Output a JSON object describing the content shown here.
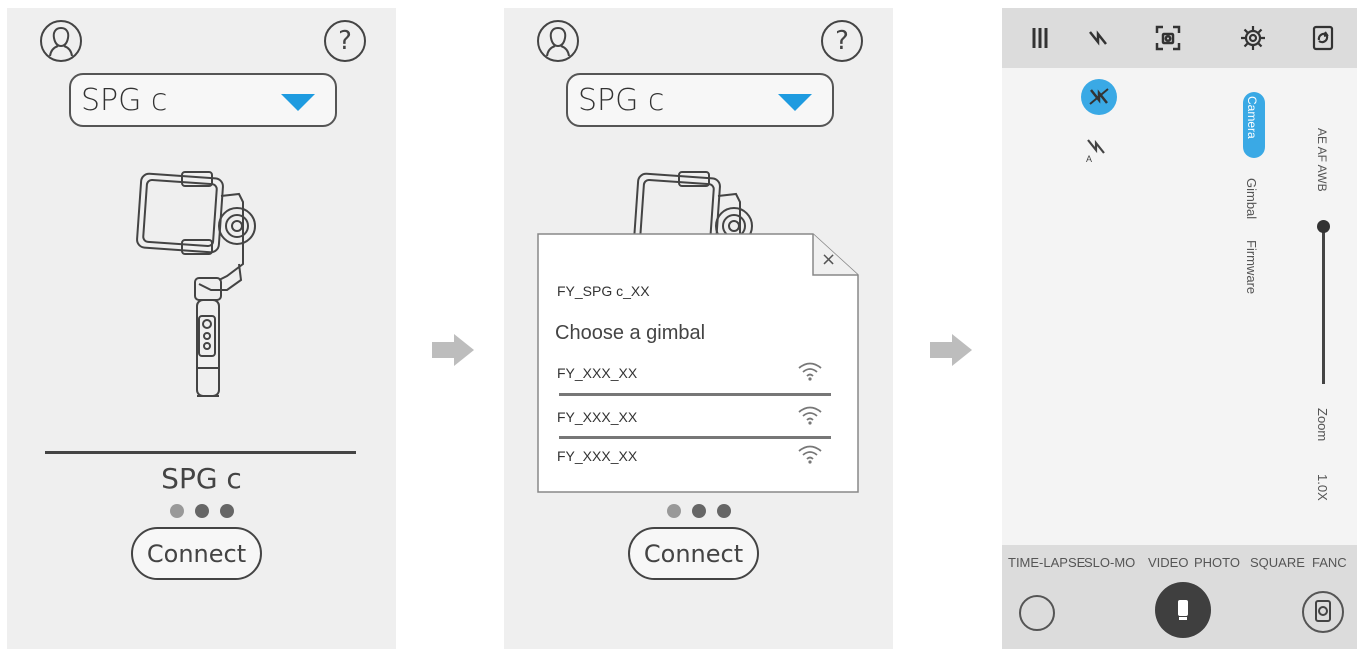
{
  "screen1": {
    "dropdown_value": "SPG c",
    "device_name": "SPG c",
    "connect_label": "Connect",
    "help_symbol": "?"
  },
  "screen2": {
    "dropdown_value": "SPG c",
    "connect_label": "Connect",
    "help_symbol": "?",
    "popup": {
      "close_symbol": "×",
      "current_ssid": "FY_SPG c_XX",
      "heading": "Choose a gimbal",
      "gimbals": [
        {
          "name": "FY_XXX_XX"
        },
        {
          "name": "FY_XXX_XX"
        },
        {
          "name": "FY_XXX_XX"
        }
      ]
    }
  },
  "screen3": {
    "side_tabs": [
      "Camera",
      "Gimbal",
      "Firmware"
    ],
    "exposure_label": "AE AF AWB",
    "zoom_label": "Zoom",
    "zoom_value": "1.0X",
    "zoom_level": 0.0,
    "modes": [
      "TIME-LAPSE",
      "SLO-MO",
      "VIDEO",
      "PHOTO",
      "SQUARE",
      "FANC"
    ],
    "top_icons": [
      "grid-lines-icon",
      "flash-icon",
      "focus-frame-icon",
      "settings-gear-icon",
      "switch-camera-icon"
    ]
  },
  "colors": {
    "accent": "#1e9be0",
    "screen_bg": "#efefef",
    "bar_bg": "#dcdcdc",
    "arrow": "#bdbdbd"
  }
}
